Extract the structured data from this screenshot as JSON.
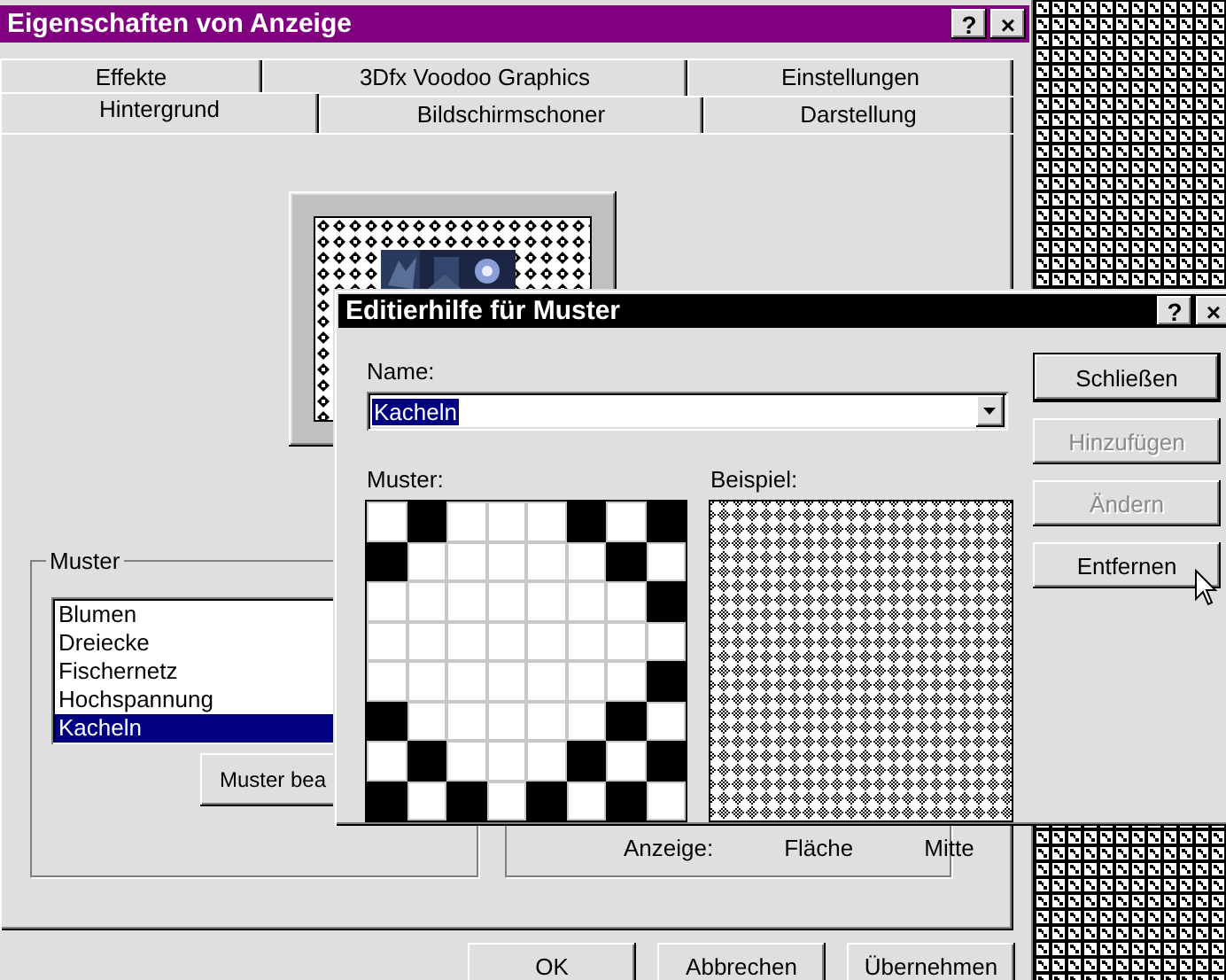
{
  "window": {
    "title": "Eigenschaften von Anzeige",
    "help_button": "?",
    "close_button": "×"
  },
  "tab_rows": [
    {
      "tabs": [
        {
          "label": "Effekte",
          "selected": false
        },
        {
          "label": "3Dfx Voodoo Graphics",
          "selected": false
        },
        {
          "label": "Einstellungen",
          "selected": false
        }
      ]
    },
    {
      "tabs": [
        {
          "label": "Hintergrund",
          "selected": true
        },
        {
          "label": "Bildschirmschoner",
          "selected": false
        },
        {
          "label": "Darstellung",
          "selected": false
        }
      ]
    }
  ],
  "pattern_group": {
    "label": "Muster",
    "items": [
      {
        "label": "Blumen",
        "selected": false
      },
      {
        "label": "Dreiecke",
        "selected": false
      },
      {
        "label": "Fischernetz",
        "selected": false
      },
      {
        "label": "Hochspannung",
        "selected": false
      },
      {
        "label": "Kacheln",
        "selected": true
      }
    ],
    "edit_button": "Muster bea"
  },
  "display_group": {
    "label": "Anzeige:",
    "options": [
      "Fläche",
      "Mitte"
    ]
  },
  "buttons": [
    "OK",
    "Abbrechen",
    "Übernehmen"
  ],
  "dialog": {
    "title": "Editierhilfe für Muster",
    "help_button": "?",
    "close_button": "×",
    "name_label": "Name:",
    "name_value": "Kacheln",
    "name_text_selected": true,
    "pattern_label": "Muster:",
    "sample_label": "Beispiel:",
    "pattern": [
      [
        false,
        true,
        false,
        false,
        false,
        true,
        false,
        true
      ],
      [
        true,
        false,
        false,
        false,
        false,
        false,
        true,
        false
      ],
      [
        false,
        false,
        false,
        false,
        false,
        false,
        false,
        true
      ],
      [
        false,
        false,
        false,
        false,
        false,
        false,
        false,
        false
      ],
      [
        false,
        false,
        false,
        false,
        false,
        false,
        false,
        true
      ],
      [
        true,
        false,
        false,
        false,
        false,
        false,
        true,
        false
      ],
      [
        false,
        true,
        false,
        false,
        false,
        true,
        false,
        true
      ],
      [
        true,
        false,
        true,
        false,
        true,
        false,
        true,
        false
      ]
    ],
    "buttons": [
      {
        "label": "Schließen",
        "default": true,
        "disabled": false
      },
      {
        "label": "Hinzufügen",
        "default": false,
        "disabled": true
      },
      {
        "label": "Ändern",
        "default": false,
        "disabled": true
      },
      {
        "label": "Entfernen",
        "default": false,
        "disabled": false
      }
    ]
  }
}
